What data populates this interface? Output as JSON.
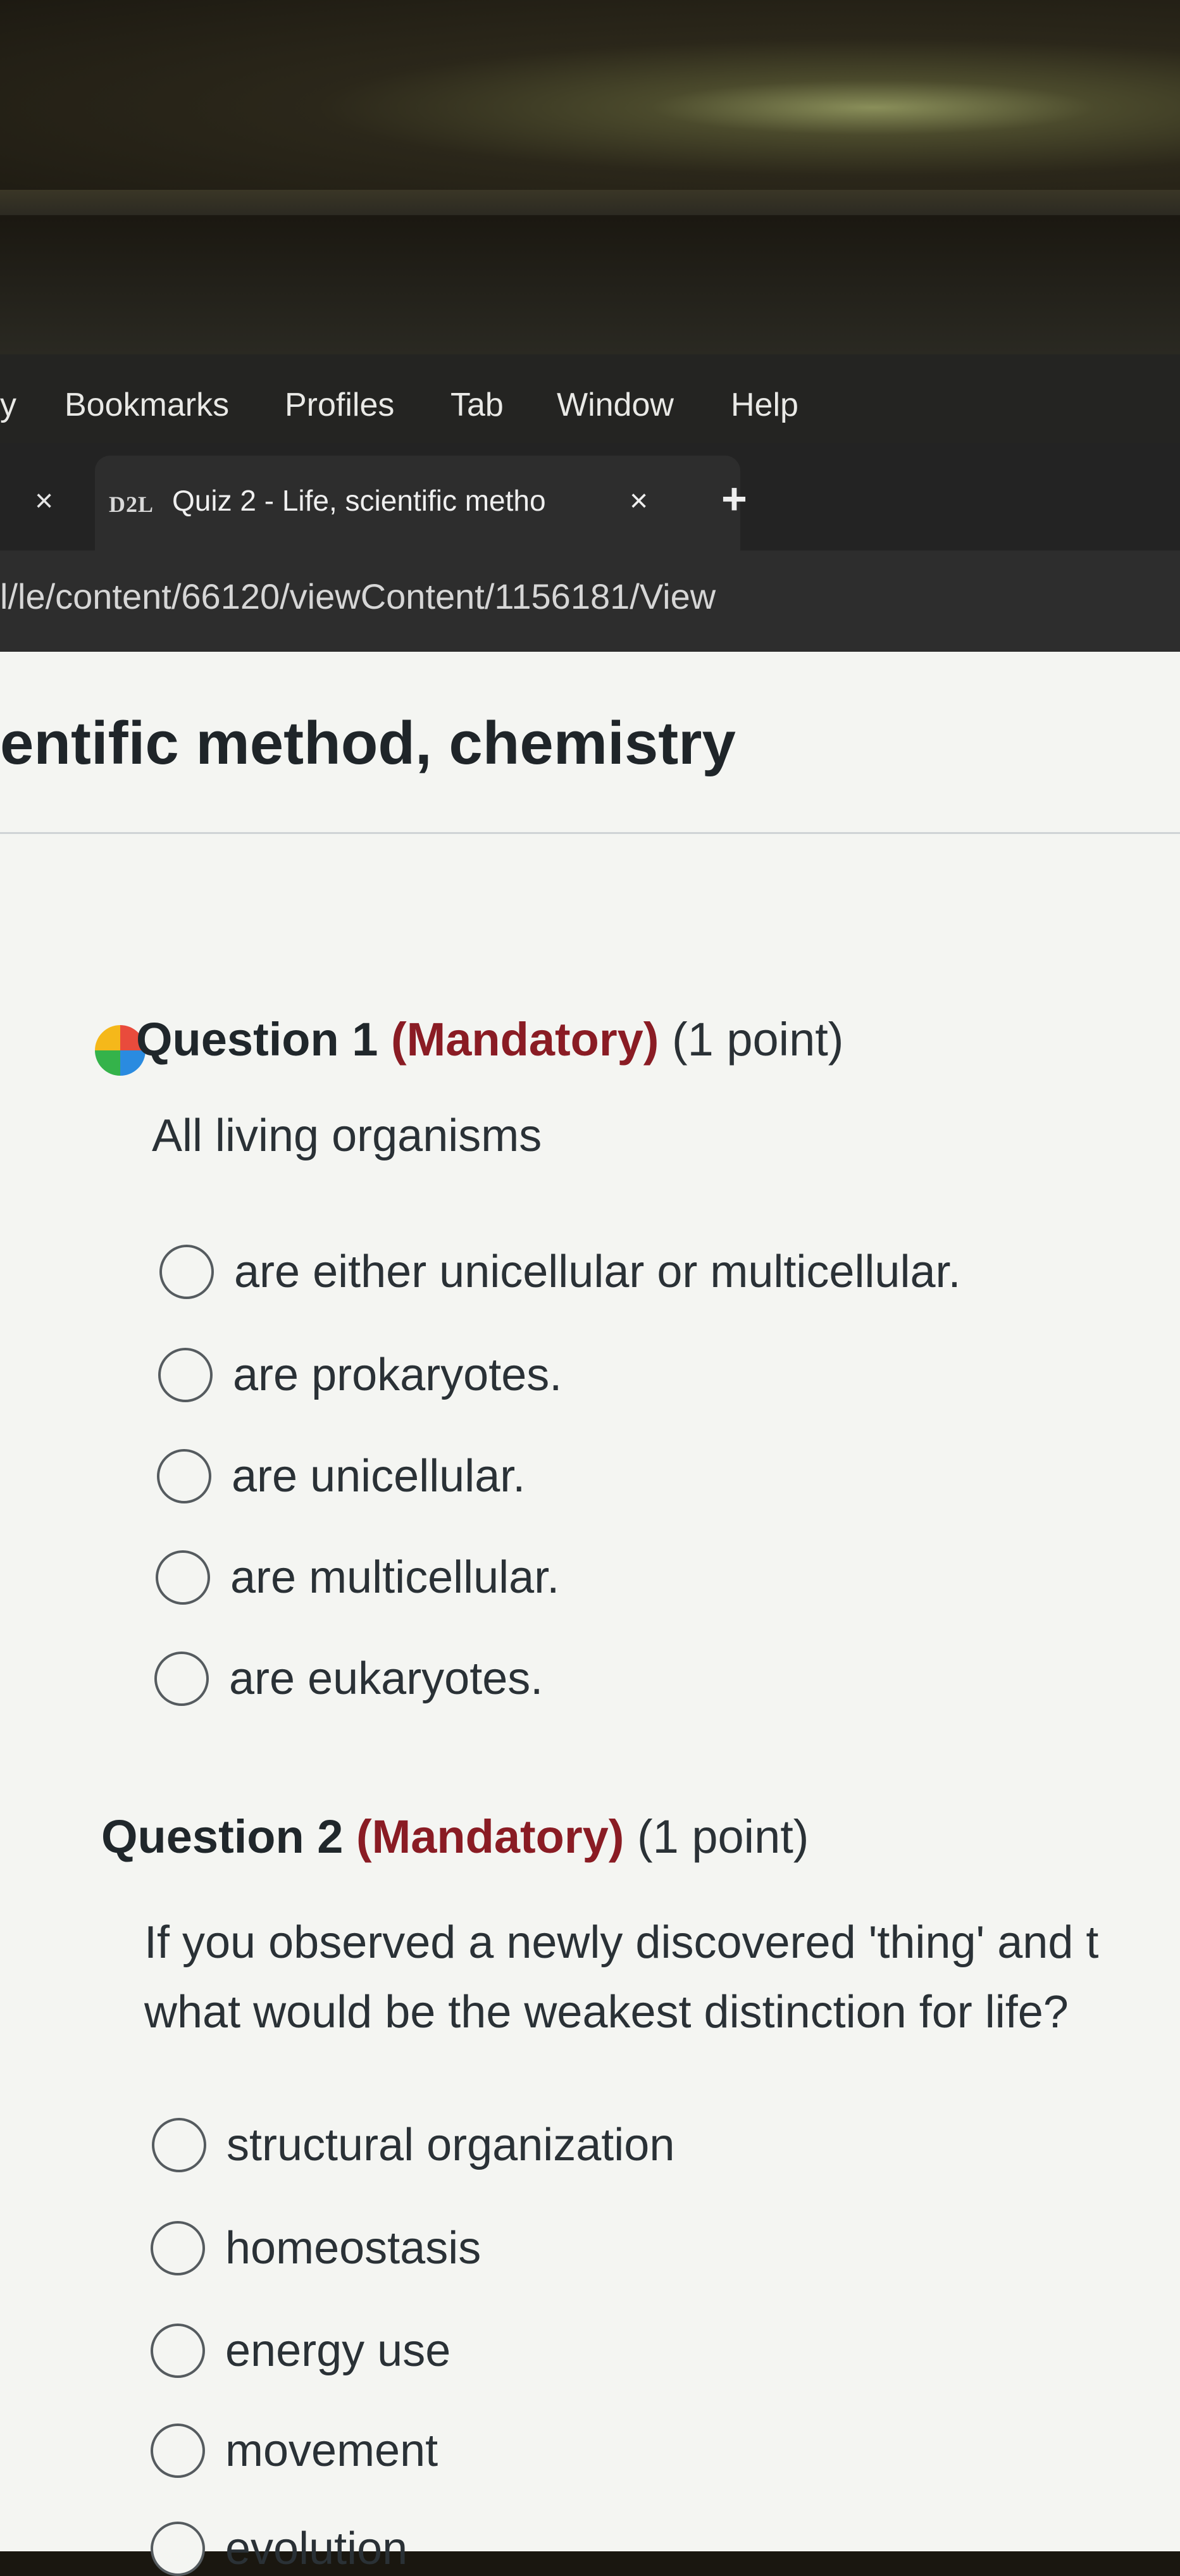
{
  "menubar": {
    "items": [
      "y",
      "Bookmarks",
      "Profiles",
      "Tab",
      "Window",
      "Help"
    ]
  },
  "tabbar": {
    "prev_close": "×",
    "favicon": "D2L",
    "title": "Quiz 2 - Life, scientific metho",
    "close": "×",
    "new_tab": "+"
  },
  "address_bar": {
    "url": "l/le/content/66120/viewContent/1156181/View"
  },
  "page": {
    "title": "entific method, chemistry"
  },
  "questions": [
    {
      "number": "Question 1",
      "mandatory": "(Mandatory)",
      "points": "(1 point)",
      "text": [
        "All living organisms"
      ],
      "options": [
        "are either unicellular or multicellular.",
        "are prokaryotes.",
        "are unicellular.",
        "are multicellular.",
        "are eukaryotes."
      ]
    },
    {
      "number": "Question 2",
      "mandatory": "(Mandatory)",
      "points": "(1 point)",
      "text": [
        "If you observed a newly discovered 'thing' and t",
        "what would be the weakest distinction for life?"
      ],
      "options": [
        "structural organization",
        "homeostasis",
        "energy use",
        "movement",
        "evolution"
      ]
    }
  ]
}
